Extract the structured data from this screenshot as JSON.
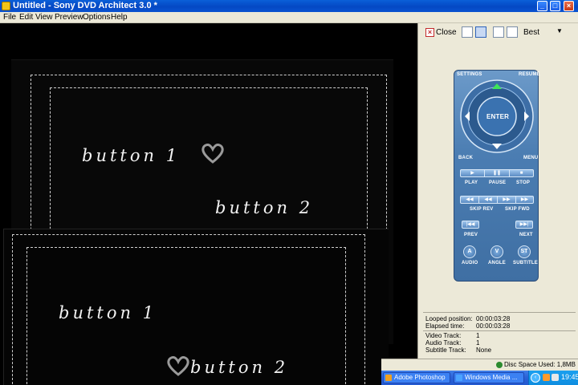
{
  "window": {
    "title": "Untitled - Sony DVD Architect 3.0 *"
  },
  "menubar": {
    "items": [
      "File",
      "Edit",
      "View",
      "Preview",
      "Options",
      "Help"
    ]
  },
  "canvas": {
    "back_page": {
      "button1": "button 1",
      "button2": "button 2"
    },
    "front_page": {
      "button1": "button 1",
      "button2": "button 2"
    }
  },
  "panel": {
    "close_label": "Close",
    "quality": "Best",
    "remote": {
      "settings": "SETTINGS",
      "resume": "RESUME",
      "enter": "ENTER",
      "back": "BACK",
      "menu": "MENU",
      "play": "PLAY",
      "pause": "PAUSE",
      "stop": "STOP",
      "skip_rev": "SKIP REV",
      "skip_fwd": "SKIP FWD",
      "prev": "PREV",
      "next": "NEXT",
      "audio": "AUDIO",
      "angle": "ANGLE",
      "subtitle": "SUBTITLE",
      "audio_btn": "A",
      "angle_btn": "V",
      "subtitle_btn": "ST"
    },
    "info": {
      "looped_label": "Looped position:",
      "looped_value": "00:00:03:28",
      "elapsed_label": "Elapsed time:",
      "elapsed_value": "00:00:03:28",
      "video_label": "Video Track:",
      "video_value": "1",
      "audio_label": "Audio Track:",
      "audio_value": "1",
      "subtitle_label": "Subtitle Track:",
      "subtitle_value": "None"
    }
  },
  "statusbar": {
    "disc_space": "Disc Space Used: 1,8MB"
  },
  "taskbar": {
    "tasks": [
      "Adobe Photoshop",
      "Windows Media ..."
    ],
    "clock": "19:45"
  },
  "colors": {
    "title_bar": "#0448c4",
    "panel_bg": "#ece9d8",
    "remote": "#4b7db2",
    "canvas_bg": "#000000"
  }
}
